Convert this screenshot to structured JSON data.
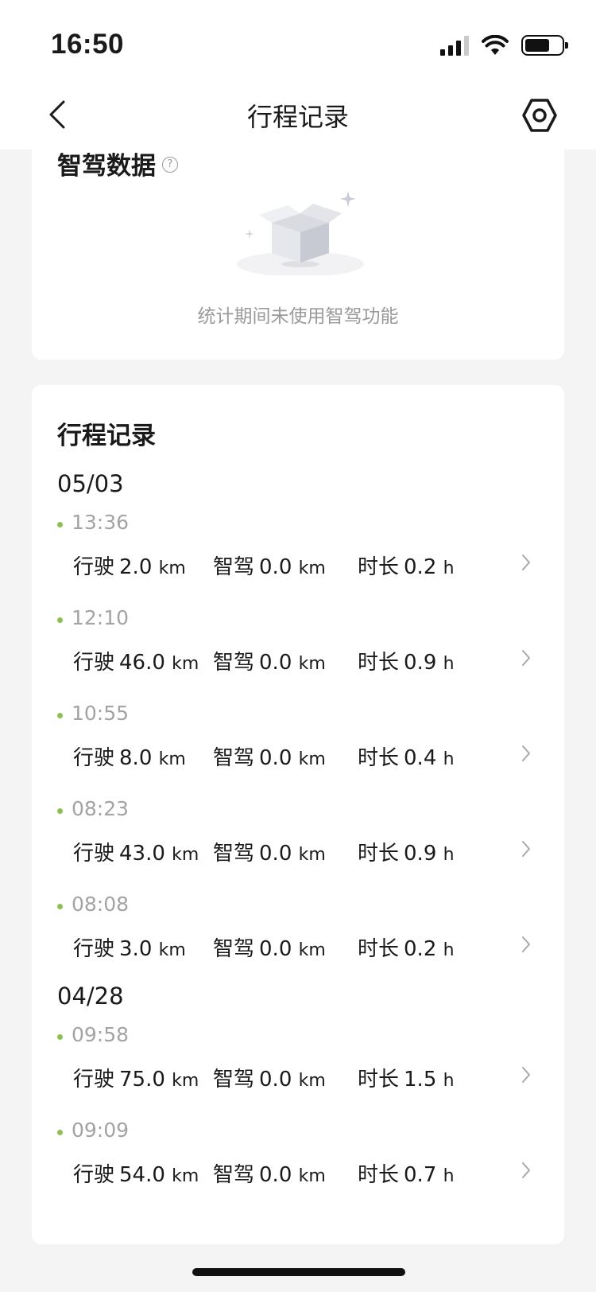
{
  "status_bar": {
    "time": "16:50"
  },
  "nav": {
    "title": "行程记录"
  },
  "smart_section": {
    "title": "智驾数据",
    "help_icon": "?",
    "empty_message": "统计期间未使用智驾功能"
  },
  "trips_section": {
    "title": "行程记录",
    "groups": [
      {
        "date": "05/03",
        "trips": [
          {
            "time": "13:36",
            "drive_label": "行驶",
            "drive": "2.0",
            "smart_label": "智驾",
            "smart": "0.0",
            "dur_label": "时长",
            "duration": "0.2",
            "km": "km",
            "h": "h"
          },
          {
            "time": "12:10",
            "drive_label": "行驶",
            "drive": "46.0",
            "smart_label": "智驾",
            "smart": "0.0",
            "dur_label": "时长",
            "duration": "0.9",
            "km": "km",
            "h": "h"
          },
          {
            "time": "10:55",
            "drive_label": "行驶",
            "drive": "8.0",
            "smart_label": "智驾",
            "smart": "0.0",
            "dur_label": "时长",
            "duration": "0.4",
            "km": "km",
            "h": "h"
          },
          {
            "time": "08:23",
            "drive_label": "行驶",
            "drive": "43.0",
            "smart_label": "智驾",
            "smart": "0.0",
            "dur_label": "时长",
            "duration": "0.9",
            "km": "km",
            "h": "h"
          },
          {
            "time": "08:08",
            "drive_label": "行驶",
            "drive": "3.0",
            "smart_label": "智驾",
            "smart": "0.0",
            "dur_label": "时长",
            "duration": "0.2",
            "km": "km",
            "h": "h"
          }
        ]
      },
      {
        "date": "04/28",
        "trips": [
          {
            "time": "09:58",
            "drive_label": "行驶",
            "drive": "75.0",
            "smart_label": "智驾",
            "smart": "0.0",
            "dur_label": "时长",
            "duration": "1.5",
            "km": "km",
            "h": "h"
          },
          {
            "time": "09:09",
            "drive_label": "行驶",
            "drive": "54.0",
            "smart_label": "智驾",
            "smart": "0.0",
            "dur_label": "时长",
            "duration": "0.7",
            "km": "km",
            "h": "h"
          }
        ]
      }
    ]
  },
  "colors": {
    "accent_dot": "#8cc152",
    "muted_text": "#9a9a9a",
    "background": "#f4f4f4"
  },
  "icons": {
    "back": "chevron-left-icon",
    "settings": "hexagon-gear-icon",
    "row": "chevron-right-icon",
    "empty": "empty-box-icon"
  }
}
